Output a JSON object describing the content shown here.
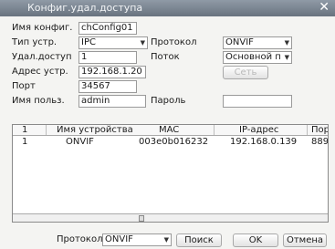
{
  "window": {
    "title": "Конфиг.удал.доступа"
  },
  "form": {
    "config_name_label": "Имя конфиг.",
    "config_name_value": "chConfig01",
    "device_type_label": "Тип устр.",
    "device_type_value": "IPC",
    "protocol_label": "Протокол",
    "protocol_value": "ONVIF",
    "remote_access_label": "Удал.доступ",
    "remote_access_value": "1",
    "stream_label": "Поток",
    "stream_value": "Основной п",
    "address_label": "Адрес устр.",
    "address_value": "192.168.1.20",
    "network_button": "Сеть",
    "port_label": "Порт",
    "port_value": "34567",
    "username_label": "Имя польз.",
    "username_value": "admin",
    "password_label": "Пароль",
    "password_value": ""
  },
  "table": {
    "columns": [
      "1",
      "Имя устройства",
      "MAC",
      "IP-адрес",
      "Пор"
    ],
    "rows": [
      [
        "1",
        "ONVIF",
        "003e0b016232",
        "192.168.0.139",
        "889"
      ]
    ]
  },
  "footer": {
    "protocol_label": "Протокол",
    "protocol_value": "ONVIF",
    "search_button": "Поиск",
    "ok_button": "OK",
    "cancel_button": "Отмена"
  }
}
